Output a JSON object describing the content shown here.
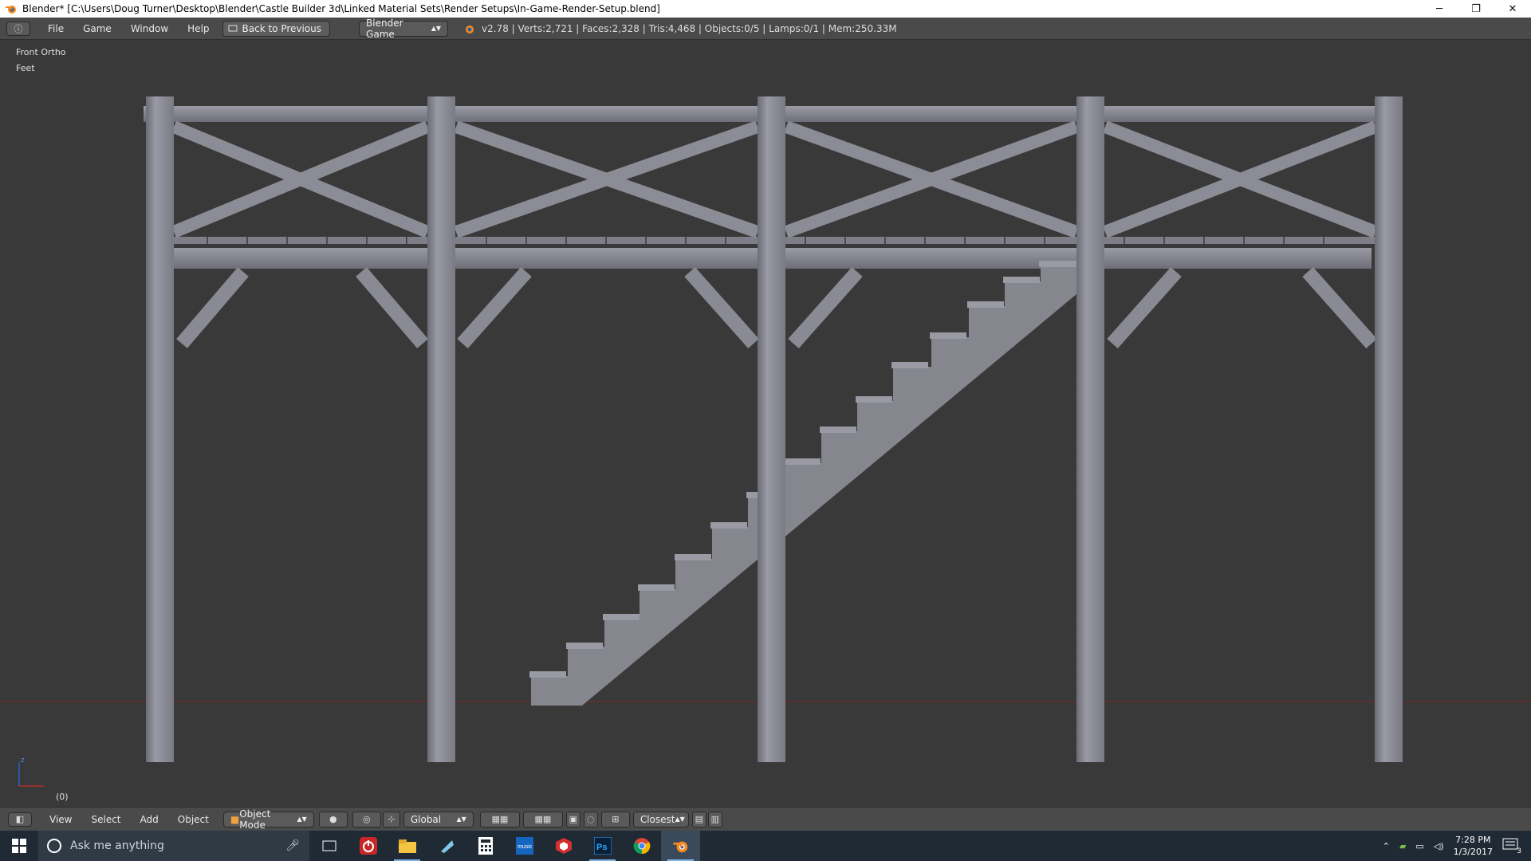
{
  "window": {
    "title": "Blender* [C:\\Users\\Doug Turner\\Desktop\\Blender\\Castle Builder 3d\\Linked Material Sets\\Render Setups\\In-Game-Render-Setup.blend]",
    "minimize": "─",
    "restore": "❐",
    "close": "✕"
  },
  "infobar": {
    "menus": [
      "File",
      "Game",
      "Window",
      "Help"
    ],
    "back_button": "Back to Previous",
    "engine": "Blender Game",
    "stats": "v2.78 | Verts:2,721 | Faces:2,328 | Tris:4,468 | Objects:0/5 | Lamps:0/1 | Mem:250.33M"
  },
  "viewport": {
    "view_name": "Front Ortho",
    "units": "Feet",
    "frame": "(0)",
    "axis_z": "z"
  },
  "vp_header": {
    "menus": [
      "View",
      "Select",
      "Add",
      "Object"
    ],
    "mode": "Object Mode",
    "orientation": "Global",
    "snap_target": "Closest"
  },
  "taskbar": {
    "search_placeholder": "Ask me anything",
    "time": "7:28 PM",
    "date": "1/3/2017",
    "notifications": "3",
    "apps": [
      "task-view-icon",
      "power-app-icon",
      "file-explorer-icon",
      "app-icon",
      "calculator-icon",
      "music-app-icon",
      "sketchup-icon",
      "photoshop-icon",
      "chrome-icon",
      "blender-icon"
    ]
  },
  "colors": {
    "viewport_bg": "#393939",
    "header_bg": "#4a4a4a",
    "mesh": "#8a8a94",
    "mesh_light": "#9a9aa4",
    "mesh_dark": "#6c6c76",
    "x_axis": "#8a2a2a",
    "taskbar": "#1f2a35"
  }
}
